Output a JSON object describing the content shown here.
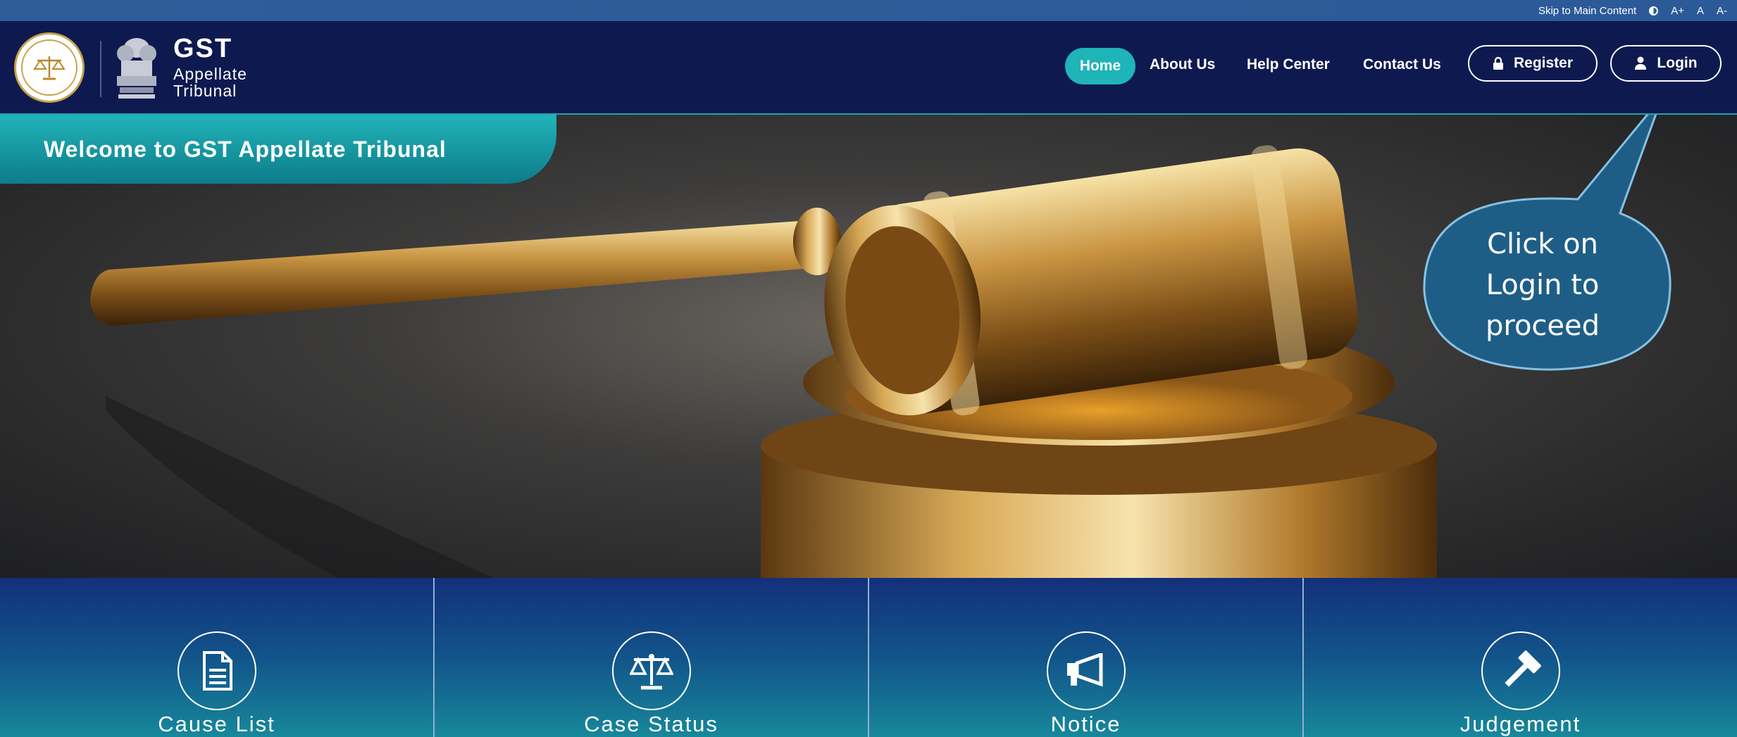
{
  "utility_bar": {
    "skip_link": "Skip to Main Content",
    "font_increase": "A+",
    "font_normal": "A",
    "font_decrease": "A-"
  },
  "header": {
    "brand_title": "GST",
    "brand_sub1": "Appellate",
    "brand_sub2": "Tribunal",
    "nav": {
      "home": "Home",
      "about": "About Us",
      "help": "Help Center",
      "contact": "Contact Us"
    },
    "register_label": "Register",
    "login_label": "Login"
  },
  "hero": {
    "welcome": "Welcome to GST Appellate Tribunal",
    "callout_lines": [
      "Click on",
      "Login to",
      "proceed"
    ]
  },
  "cards": [
    {
      "label": "Cause List",
      "icon": "document-icon"
    },
    {
      "label": "Case Status",
      "icon": "scales-icon"
    },
    {
      "label": "Notice",
      "icon": "megaphone-icon"
    },
    {
      "label": "Judgement",
      "icon": "gavel-icon"
    }
  ],
  "colors": {
    "header_bg": "#0e1a4f",
    "accent_teal": "#1fb4b8",
    "util_bar": "#2f5d9a",
    "callout_fill": "#1e5e86"
  }
}
